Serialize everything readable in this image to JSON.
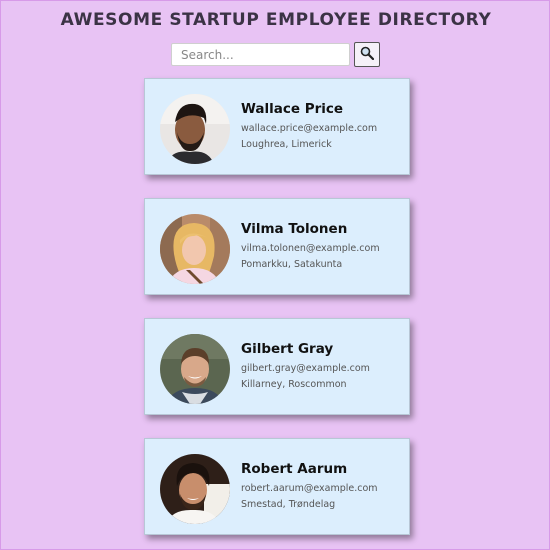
{
  "header": {
    "title": "AWESOME STARTUP EMPLOYEE DIRECTORY"
  },
  "search": {
    "placeholder": "Search...",
    "value": "",
    "button_icon": "magnifier-icon"
  },
  "employees": [
    {
      "name": "Wallace Price",
      "email": "wallace.price@example.com",
      "location": "Loughrea, Limerick"
    },
    {
      "name": "Vilma Tolonen",
      "email": "vilma.tolonen@example.com",
      "location": "Pomarkku, Satakunta"
    },
    {
      "name": "Gilbert Gray",
      "email": "gilbert.gray@example.com",
      "location": "Killarney, Roscommon"
    },
    {
      "name": "Robert Aarum",
      "email": "robert.aarum@example.com",
      "location": "Smestad, Trøndelag"
    }
  ],
  "colors": {
    "background": "#e8c3f4",
    "card": "#dceefd",
    "title": "#3b3345"
  }
}
